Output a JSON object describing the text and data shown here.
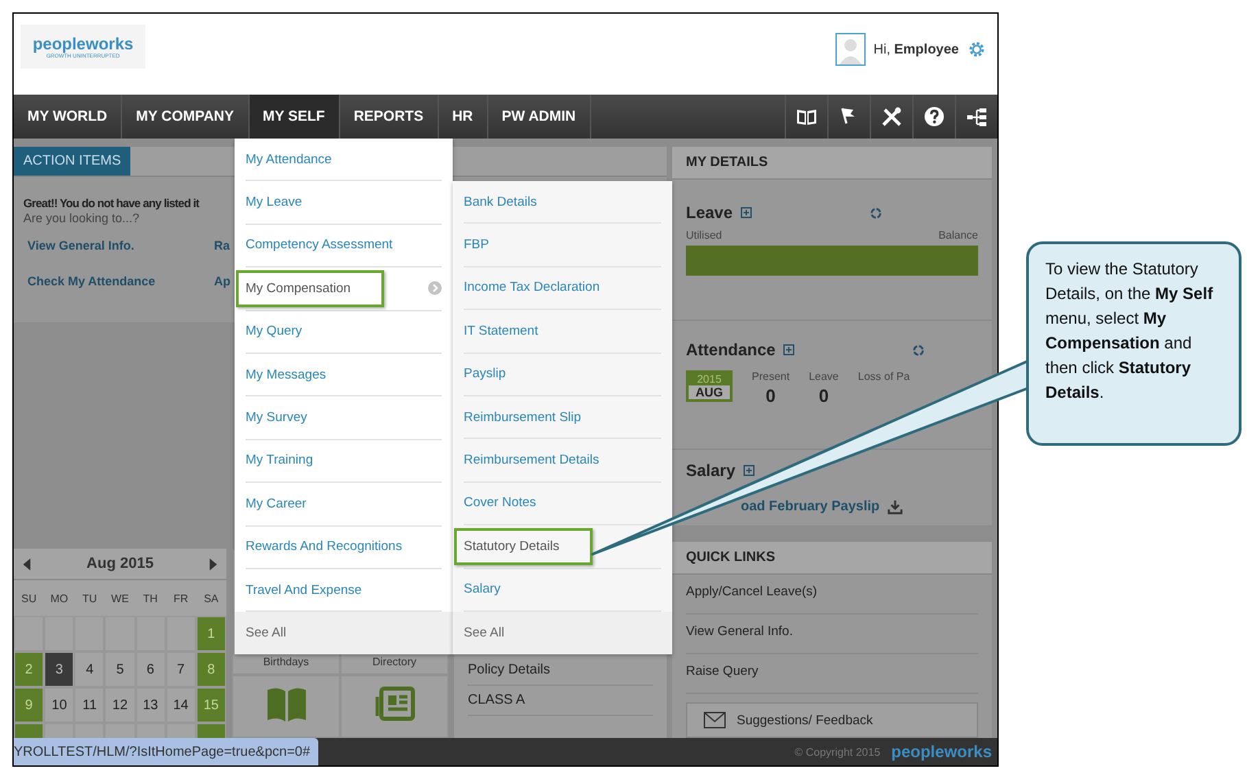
{
  "header": {
    "logo": "peopleworks",
    "tagline": "GROWTH UNINTERRUPTED",
    "greeting": "Hi, **Employee**"
  },
  "nav": [
    {
      "label": "MY WORLD",
      "selected": false
    },
    {
      "label": "MY COMPANY",
      "selected": false
    },
    {
      "label": "MY SELF",
      "selected": true
    },
    {
      "label": "REPORTS",
      "selected": false
    },
    {
      "label": "HR",
      "selected": false
    },
    {
      "label": "PW ADMIN",
      "selected": false
    }
  ],
  "action_items": {
    "tab": "ACTION ITEMS",
    "message": "Great!! You do not have any listed it",
    "prompt": "Are you looking to...?",
    "links": [
      "View General Info.",
      "Ra",
      "Check My Attendance",
      "Ap"
    ]
  },
  "calendar": {
    "month": "Aug 2015",
    "weekdays": [
      "SU",
      "MO",
      "TU",
      "WE",
      "TH",
      "FR",
      "SA"
    ],
    "weeks": [
      [
        {
          "kind": "blank"
        },
        {
          "kind": "blank"
        },
        {
          "kind": "blank"
        },
        {
          "kind": "blank"
        },
        {
          "kind": "blank"
        },
        {
          "kind": "blank"
        },
        {
          "kind": "weekend",
          "day": "1"
        }
      ],
      [
        {
          "kind": "weekend",
          "day": "2"
        },
        {
          "kind": "today",
          "day": "3"
        },
        {
          "kind": "weekday",
          "day": "4"
        },
        {
          "kind": "weekday",
          "day": "5"
        },
        {
          "kind": "weekday",
          "day": "6"
        },
        {
          "kind": "weekday",
          "day": "7"
        },
        {
          "kind": "weekend",
          "day": "8"
        }
      ],
      [
        {
          "kind": "weekend",
          "day": "9"
        },
        {
          "kind": "weekday",
          "day": "10"
        },
        {
          "kind": "weekday",
          "day": "11"
        },
        {
          "kind": "weekday",
          "day": "12"
        },
        {
          "kind": "weekday",
          "day": "13"
        },
        {
          "kind": "weekday",
          "day": "14"
        },
        {
          "kind": "weekend",
          "day": "15"
        }
      ],
      [
        {
          "kind": "weekend"
        },
        {
          "kind": "weekday"
        },
        {
          "kind": "weekday"
        },
        {
          "kind": "weekday"
        },
        {
          "kind": "weekday"
        },
        {
          "kind": "weekday"
        },
        {
          "kind": "weekend"
        }
      ]
    ]
  },
  "tiles": [
    {
      "label": "Birthdays",
      "kind": "book"
    },
    {
      "label": "Directory",
      "kind": "directory"
    }
  ],
  "policy": [
    "Policy Details",
    "CLASS A"
  ],
  "my_details": {
    "title": "MY DETAILS",
    "leave": {
      "title": "Leave",
      "utilised_label": "Utilised",
      "balance_label": "Balance",
      "level": 1
    },
    "attendance": {
      "title": "Attendance",
      "year": "2015",
      "month": "AUG",
      "stats": [
        {
          "label": "Present",
          "value": "0"
        },
        {
          "label": "Leave",
          "value": "0"
        },
        {
          "label": "Loss of Pa"
        }
      ]
    },
    "salary": {
      "title": "Salary",
      "link": "oad February Payslip"
    }
  },
  "quick_links": {
    "title": "QUICK LINKS",
    "items": [
      "Apply/Cancel Leave(s)",
      "View General Info.",
      "Raise Query"
    ],
    "feedback": "Suggestions/ Feedback"
  },
  "footer": {
    "url": "YROLLTEST/HLM/?IsItHomePage=true&pcn=0#",
    "copyright": "© Copyright 2015",
    "logo": "peopleworks"
  },
  "menu": {
    "items": [
      {
        "label": "My Attendance",
        "highlighted": false,
        "has_submenu": false
      },
      {
        "label": "My Leave",
        "highlighted": false,
        "has_submenu": false
      },
      {
        "label": "Competency Assessment",
        "highlighted": false,
        "has_submenu": false
      },
      {
        "label": "My Compensation",
        "highlighted": true,
        "has_submenu": true
      },
      {
        "label": "My Query",
        "highlighted": false,
        "has_submenu": false
      },
      {
        "label": "My Messages",
        "highlighted": false,
        "has_submenu": false
      },
      {
        "label": "My Survey",
        "highlighted": false,
        "has_submenu": false
      },
      {
        "label": "My Training",
        "highlighted": false,
        "has_submenu": false
      },
      {
        "label": "My Career",
        "highlighted": false,
        "has_submenu": false
      },
      {
        "label": "Rewards And Recognitions",
        "highlighted": false,
        "has_submenu": false
      },
      {
        "label": "Travel And Expense",
        "highlighted": false,
        "has_submenu": false
      }
    ],
    "see_all": "See All"
  },
  "submenu": {
    "items": [
      {
        "label": "Bank Details",
        "highlighted": false
      },
      {
        "label": "FBP",
        "highlighted": false
      },
      {
        "label": "Income Tax Declaration",
        "highlighted": false
      },
      {
        "label": "IT Statement",
        "highlighted": false
      },
      {
        "label": "Payslip",
        "highlighted": false
      },
      {
        "label": "Reimbursement Slip",
        "highlighted": false
      },
      {
        "label": "Reimbursement Details",
        "highlighted": false
      },
      {
        "label": "Cover Notes",
        "highlighted": false
      },
      {
        "label": "Statutory Details",
        "highlighted": true
      },
      {
        "label": "Salary",
        "highlighted": false
      }
    ],
    "see_all": "See All"
  },
  "callout": {
    "text": "To view the Statutory Details, on the **My Self** menu, select **My Compensation** and then click **Statutory Details**."
  }
}
